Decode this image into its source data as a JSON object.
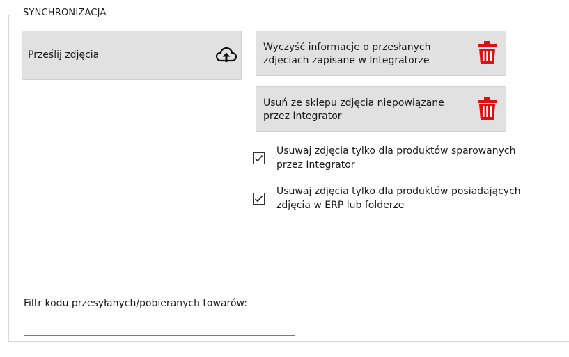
{
  "group": {
    "title": "SYNCHRONIZACJA"
  },
  "buttons": {
    "upload": {
      "label": "Prześlij zdjęcia",
      "icon": "cloud-upload-icon"
    },
    "clear": {
      "label": "Wyczyść informacje o przesłanych zdjęciach zapisane w Integratorze",
      "icon": "trash-icon"
    },
    "remove": {
      "label": "Usuń ze sklepu zdjęcia niepowiązane przez Integrator",
      "icon": "trash-icon"
    }
  },
  "checkboxes": [
    {
      "label": "Usuwaj zdjęcia tylko dla produktów sparowanych przez Integrator",
      "checked": true
    },
    {
      "label": "Usuwaj zdjęcia tylko dla produktów posiadających zdjęcia w ERP lub folderze",
      "checked": true
    }
  ],
  "filter": {
    "label": "Filtr kodu przesyłanych/pobieranych towarów:",
    "value": "",
    "placeholder": ""
  },
  "colors": {
    "button_bg": "#e1e1e1",
    "trash_red": "#e01010",
    "border": "#d6d6d6"
  }
}
